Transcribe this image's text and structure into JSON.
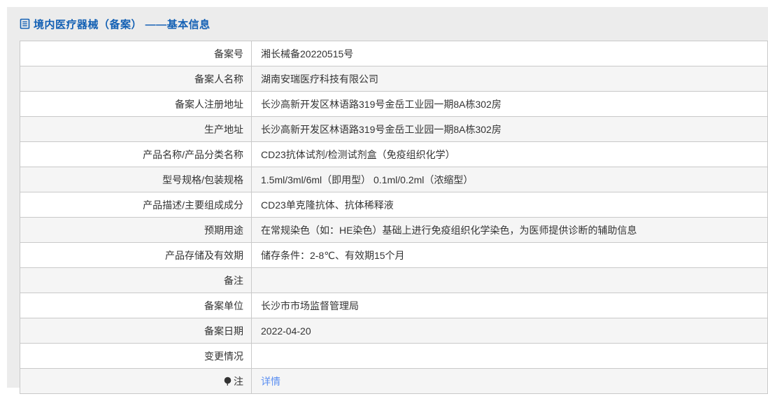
{
  "page": {
    "title": "境内医疗器械（备案） ——基本信息"
  },
  "colors": {
    "title_blue": "#1360b4",
    "link_blue": "#5b8ff2",
    "panel_bg": "#ececec",
    "row_alt_bg": "#f5f5f5",
    "border": "#c9c9c9",
    "text": "#333333"
  },
  "icons": {
    "title_icon": "document-icon",
    "note_icon": "balloon-icon"
  },
  "table": {
    "rows": [
      {
        "label": "备案号",
        "value": "湘长械备20220515号"
      },
      {
        "label": "备案人名称",
        "value": "湖南安瑞医疗科技有限公司"
      },
      {
        "label": "备案人注册地址",
        "value": "长沙高新开发区林语路319号金岳工业园一期8A栋302房"
      },
      {
        "label": "生产地址",
        "value": "长沙高新开发区林语路319号金岳工业园一期8A栋302房"
      },
      {
        "label": "产品名称/产品分类名称",
        "value": "CD23抗体试剂/检测试剂盒（免疫组织化学）"
      },
      {
        "label": "型号规格/包装规格",
        "value": "1.5ml/3ml/6ml（即用型） 0.1ml/0.2ml（浓缩型）"
      },
      {
        "label": "产品描述/主要组成成分",
        "value": "CD23单克隆抗体、抗体稀释液"
      },
      {
        "label": "预期用途",
        "value": "在常规染色（如：HE染色）基础上进行免疫组织化学染色，为医师提供诊断的辅助信息"
      },
      {
        "label": "产品存储及有效期",
        "value": "储存条件：2-8℃、有效期15个月"
      },
      {
        "label": "备注",
        "value": ""
      },
      {
        "label": "备案单位",
        "value": "长沙市市场监督管理局"
      },
      {
        "label": "备案日期",
        "value": "2022-04-20"
      },
      {
        "label": "变更情况",
        "value": ""
      },
      {
        "label": "注",
        "value": "详情",
        "label_icon": "balloon-icon",
        "value_is_link": true
      }
    ]
  }
}
